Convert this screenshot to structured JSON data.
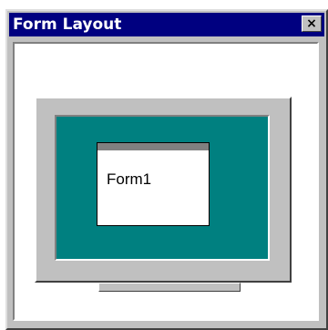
{
  "window": {
    "title": "Form Layout",
    "close_glyph": "×",
    "close_icon": "close-icon"
  },
  "preview": {
    "form_caption": "Form1"
  },
  "colors": {
    "title_bar": "#000080",
    "desktop": "#008080",
    "face": "#c0c0c0"
  }
}
